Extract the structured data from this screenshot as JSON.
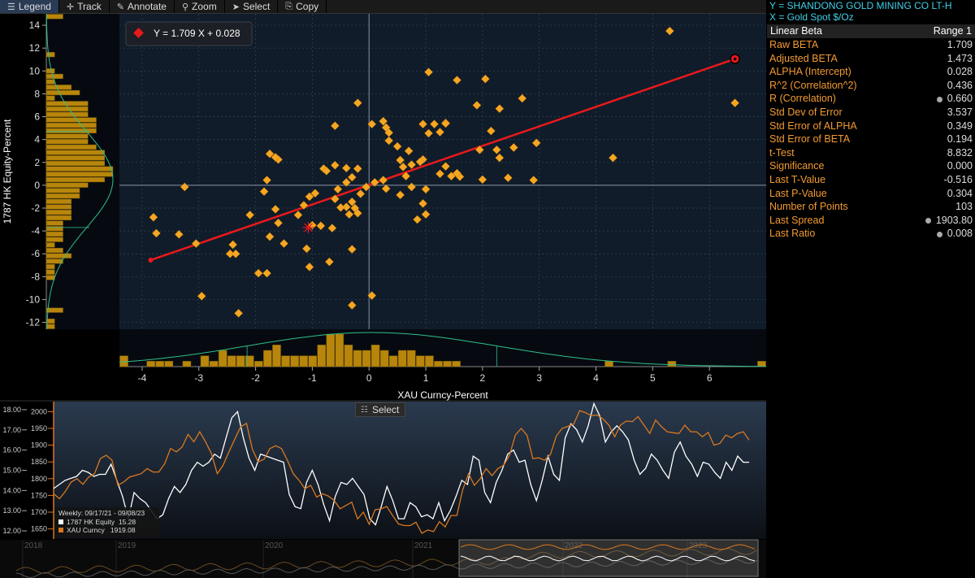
{
  "toolbar": {
    "legend": "Legend",
    "track": "Track",
    "annotate": "Annotate",
    "zoom": "Zoom",
    "select": "Select",
    "copy": "Copy"
  },
  "info": {
    "y_label": "Y = SHANDONG GOLD MINING CO LT-H",
    "x_label": "X = Gold Spot  $/Oz"
  },
  "stats": {
    "header_left": "Linear Beta",
    "header_right": "Range 1",
    "rows": [
      {
        "label": "Raw BETA",
        "value": "1.709"
      },
      {
        "label": "Adjusted BETA",
        "value": "1.473"
      },
      {
        "label": "ALPHA (Intercept)",
        "value": "0.028"
      },
      {
        "label": "R^2 (Correlation^2)",
        "value": "0.436"
      },
      {
        "label": "R (Correlation)",
        "value": "0.660"
      },
      {
        "label": "Std Dev of Error",
        "value": "3.537"
      },
      {
        "label": "Std Error of ALPHA",
        "value": "0.349"
      },
      {
        "label": "Std Error of BETA",
        "value": "0.194"
      },
      {
        "label": "t-Test",
        "value": "8.832"
      },
      {
        "label": "Significance",
        "value": "0.000"
      },
      {
        "label": "Last T-Value",
        "value": "-0.516"
      },
      {
        "label": "Last P-Value",
        "value": "0.304"
      },
      {
        "label": "Number of Points",
        "value": "103"
      },
      {
        "label": "Last Spread",
        "value": "1903.80"
      },
      {
        "label": "Last Ratio",
        "value": "0.008"
      }
    ]
  },
  "colors": {
    "accent": "#f29a33",
    "point": "#f5a623",
    "regression": "#e8191c",
    "equity_line": "#ffffff",
    "gold_line": "#d9781f",
    "bars": "#b8860b",
    "info": "#3fd0e8"
  },
  "chart_data": [
    {
      "type": "scatter",
      "title": "",
      "equation": "Y = 1.709 X + 0.028",
      "xlabel": "XAU Curncy-Percent",
      "ylabel": "1787 HK Equity-Percent",
      "xlim": [
        -4.4,
        7.0
      ],
      "ylim": [
        -12.6,
        15.0
      ],
      "xticks": [
        -4,
        -3,
        -2,
        -1,
        0,
        1,
        2,
        3,
        4,
        5,
        6
      ],
      "yticks": [
        -12,
        -10,
        -8,
        -6,
        -4,
        -2,
        0,
        2,
        4,
        6,
        8,
        10,
        12,
        14
      ],
      "grid": true,
      "regression": {
        "slope": 1.709,
        "intercept": 0.028,
        "x_from": -3.85,
        "x_to": 6.45
      },
      "last_point": {
        "x": 6.45,
        "y": 11.05
      },
      "mean_marker": {
        "x": -1.07,
        "y": -3.7
      },
      "points": [
        [
          5.3,
          13.5
        ],
        [
          6.45,
          11.05
        ],
        [
          6.45,
          7.2
        ],
        [
          1.05,
          9.9
        ],
        [
          1.55,
          9.2
        ],
        [
          2.05,
          9.3
        ],
        [
          2.3,
          6.7
        ],
        [
          2.7,
          7.6
        ],
        [
          1.9,
          7
        ],
        [
          -0.2,
          7.2
        ],
        [
          0.25,
          5.6
        ],
        [
          0.05,
          5.35
        ],
        [
          0.95,
          5.35
        ],
        [
          1.15,
          5.35
        ],
        [
          1.35,
          5.45
        ],
        [
          0.3,
          5.05
        ],
        [
          0.35,
          4.6
        ],
        [
          1.05,
          4.55
        ],
        [
          1.25,
          4.65
        ],
        [
          1.35,
          5.4
        ],
        [
          2.15,
          4.75
        ],
        [
          2.95,
          3.7
        ],
        [
          2.55,
          3.3
        ],
        [
          2.3,
          2.4
        ],
        [
          2.25,
          3.1
        ],
        [
          1.95,
          3.1
        ],
        [
          4.3,
          2.4
        ],
        [
          -0.6,
          5.2
        ],
        [
          0.35,
          3.9
        ],
        [
          0.5,
          3.4
        ],
        [
          0.7,
          3.0
        ],
        [
          0.55,
          2.2
        ],
        [
          0.75,
          1.8
        ],
        [
          0.6,
          1.6
        ],
        [
          0.95,
          2.25
        ],
        [
          0.9,
          2.05
        ],
        [
          1.25,
          1.0
        ],
        [
          1.45,
          0.8
        ],
        [
          1.6,
          0.75
        ],
        [
          1.35,
          1.65
        ],
        [
          1.55,
          1.05
        ],
        [
          2.0,
          0.5
        ],
        [
          2.45,
          0.65
        ],
        [
          2.9,
          0.45
        ],
        [
          0.75,
          -0.15
        ],
        [
          0.65,
          0.8
        ],
        [
          0.25,
          0.45
        ],
        [
          0.1,
          0.25
        ],
        [
          0.3,
          -0.3
        ],
        [
          0.55,
          -0.85
        ],
        [
          1.0,
          -0.35
        ],
        [
          0.95,
          -1.6
        ],
        [
          0.85,
          -3.0
        ],
        [
          1.0,
          -2.55
        ],
        [
          -0.05,
          -0.15
        ],
        [
          -0.15,
          -0.75
        ],
        [
          -0.3,
          -1.45
        ],
        [
          -0.4,
          -1.9
        ],
        [
          -0.35,
          -2.55
        ],
        [
          -0.2,
          -2.45
        ],
        [
          -0.25,
          -2.0
        ],
        [
          -0.5,
          -1.95
        ],
        [
          -0.55,
          -0.35
        ],
        [
          -0.6,
          -1.2
        ],
        [
          -0.4,
          1.5
        ],
        [
          -0.4,
          0.25
        ],
        [
          -0.3,
          0.7
        ],
        [
          -0.2,
          1.45
        ],
        [
          -0.6,
          1.75
        ],
        [
          -0.8,
          1.45
        ],
        [
          -0.75,
          1.25
        ],
        [
          -0.95,
          -0.7
        ],
        [
          -1.05,
          -1.0
        ],
        [
          -1.15,
          -1.75
        ],
        [
          -1.25,
          -2.6
        ],
        [
          -1.0,
          -3.5
        ],
        [
          -1.1,
          -5.55
        ],
        [
          -1.05,
          -7.15
        ],
        [
          -0.85,
          -3.55
        ],
        [
          -0.65,
          -3.75
        ],
        [
          -0.7,
          -6.7
        ],
        [
          -0.3,
          -5.6
        ],
        [
          -0.3,
          -10.5
        ],
        [
          0.05,
          -9.65
        ],
        [
          -1.6,
          2.25
        ],
        [
          -1.65,
          2.45
        ],
        [
          -1.75,
          2.75
        ],
        [
          -1.8,
          0.45
        ],
        [
          -1.85,
          -0.55
        ],
        [
          -1.65,
          -2.1
        ],
        [
          -1.6,
          -3.3
        ],
        [
          -1.75,
          -4.5
        ],
        [
          -1.8,
          -7.7
        ],
        [
          -1.5,
          -5.1
        ],
        [
          -1.95,
          -7.7
        ],
        [
          -2.1,
          -2.6
        ],
        [
          -2.4,
          -5.2
        ],
        [
          -2.45,
          -6.0
        ],
        [
          -2.35,
          -6.0
        ],
        [
          -2.3,
          -11.2
        ],
        [
          -3.05,
          -5.1
        ],
        [
          -2.95,
          -9.7
        ],
        [
          -3.35,
          -4.3
        ],
        [
          -3.75,
          -4.2
        ],
        [
          -3.8,
          -2.8
        ],
        [
          -3.25,
          -0.15
        ]
      ],
      "y_histogram_counts": [
        2,
        0,
        0,
        0,
        0,
        0,
        0,
        1,
        0,
        0,
        1,
        2,
        1,
        3,
        4,
        1,
        5,
        5,
        5,
        6,
        6,
        6,
        5,
        5,
        6,
        7,
        7,
        7,
        8,
        8,
        7,
        5,
        4,
        4,
        3,
        3,
        3,
        3,
        2,
        2,
        2,
        2,
        1,
        2,
        3,
        2,
        1,
        1,
        1,
        0,
        0,
        0,
        0,
        0,
        2,
        0,
        1,
        1
      ],
      "x_histogram_counts": [
        2,
        0,
        0,
        1,
        1,
        1,
        0,
        1,
        0,
        2,
        1,
        3,
        2,
        2,
        2,
        1,
        3,
        4,
        2,
        2,
        2,
        2,
        4,
        6,
        6,
        4,
        3,
        3,
        4,
        3,
        2,
        3,
        3,
        2,
        2,
        1,
        1,
        1,
        0,
        0,
        0,
        0,
        0,
        0,
        0,
        0,
        0,
        0,
        0,
        0,
        0,
        0,
        0,
        0,
        1,
        0,
        0,
        0,
        0,
        0,
        0,
        1,
        0,
        0,
        0,
        0,
        0,
        0,
        0,
        0,
        0,
        1
      ]
    },
    {
      "type": "line",
      "title": "",
      "range_label": "Weekly: 09/17/21 - 09/08/23",
      "x_years": [
        "2018",
        "2019",
        "2020",
        "2021",
        "2022",
        "2023"
      ],
      "left_axis": {
        "ticks": [
          "18.00",
          "17.00",
          "16.00",
          "15.00",
          "14.00",
          "13.00",
          "12.00"
        ],
        "ylim": [
          11.6,
          18.4
        ]
      },
      "right_axis": {
        "ticks": [
          "2000",
          "1950",
          "1900",
          "1850",
          "1800",
          "1750",
          "1700",
          "1650"
        ],
        "ylim": [
          1620,
          2030
        ]
      },
      "series": [
        {
          "name": "1787 HK Equity",
          "last": "15.28",
          "axis": "left",
          "values": [
            14.1,
            14.3,
            14.5,
            14.6,
            14.7,
            15,
            14.9,
            14.7,
            14.8,
            14.8,
            15.3,
            14.5,
            13.7,
            12.6,
            13.9,
            13.6,
            13.4,
            13,
            12.6,
            12.8,
            13.6,
            14.2,
            13.9,
            14.3,
            15,
            15.4,
            15.2,
            15.4,
            15.8,
            15.6,
            16.6,
            17.6,
            17.9,
            16.6,
            15.6,
            15,
            15.8,
            15.7,
            15.6,
            15.5,
            15.4,
            13.8,
            13.2,
            13.1,
            14.4,
            15,
            14.3,
            13.3,
            12.5,
            13.7,
            14.4,
            14.3,
            14.6,
            14.2,
            13.8,
            12.6,
            12.3,
            13.2,
            14.2,
            13.5,
            12.6,
            12.6,
            13.4,
            13.2,
            12.7,
            12.8,
            12.6,
            13.4,
            12.5,
            13,
            13.7,
            14.5,
            14.3,
            15.7,
            15.5,
            13.9,
            13.4,
            14.4,
            15,
            15.8,
            16,
            15.4,
            15.5,
            14.3,
            13.5,
            14.5,
            15.7,
            14.8,
            14.5,
            16.6,
            17.3,
            17,
            16.4,
            17.2,
            18.3,
            17.7,
            16.4,
            16.9,
            17.2,
            16.9,
            16.5,
            15.5,
            14.8,
            15.1,
            15.8,
            15.5,
            15,
            14.6,
            15.9,
            16.4,
            15.7,
            15.3,
            14.7,
            15.4,
            15.3,
            14.9,
            14.6,
            15.4,
            15,
            15.7,
            15.4,
            15.4
          ]
        },
        {
          "name": "XAU Curncy",
          "last": "1919.08",
          "axis": "right",
          "values": [
            1755,
            1740,
            1762,
            1790,
            1800,
            1783,
            1805,
            1815,
            1860,
            1870,
            1855,
            1780,
            1790,
            1805,
            1810,
            1815,
            1830,
            1820,
            1820,
            1845,
            1890,
            1880,
            1895,
            1932,
            1910,
            1940,
            1910,
            1875,
            1815,
            1840,
            1880,
            1918,
            1955,
            1965,
            1888,
            1850,
            1858,
            1890,
            1898,
            1890,
            1855,
            1815,
            1795,
            1770,
            1780,
            1745,
            1755,
            1748,
            1735,
            1710,
            1720,
            1730,
            1680,
            1700,
            1664,
            1707,
            1710,
            1717,
            1690,
            1665,
            1660,
            1660,
            1670,
            1637,
            1647,
            1642,
            1672,
            1656,
            1690,
            1690,
            1767,
            1815,
            1780,
            1800,
            1830,
            1809,
            1830,
            1840,
            1870,
            1930,
            1950,
            1929,
            1860,
            1862,
            1855,
            1872,
            1927,
            1950,
            1956,
            1963,
            2003,
            1997,
            1988,
            1990,
            1978,
            1960,
            1925,
            1960,
            1972,
            1970,
            1985,
            1960,
            1935,
            1975,
            1955,
            1940,
            1937,
            1935,
            1960,
            1940,
            1940,
            1925,
            1938,
            1900,
            1905,
            1930,
            1922,
            1935,
            1940,
            1915
          ]
        }
      ]
    }
  ]
}
